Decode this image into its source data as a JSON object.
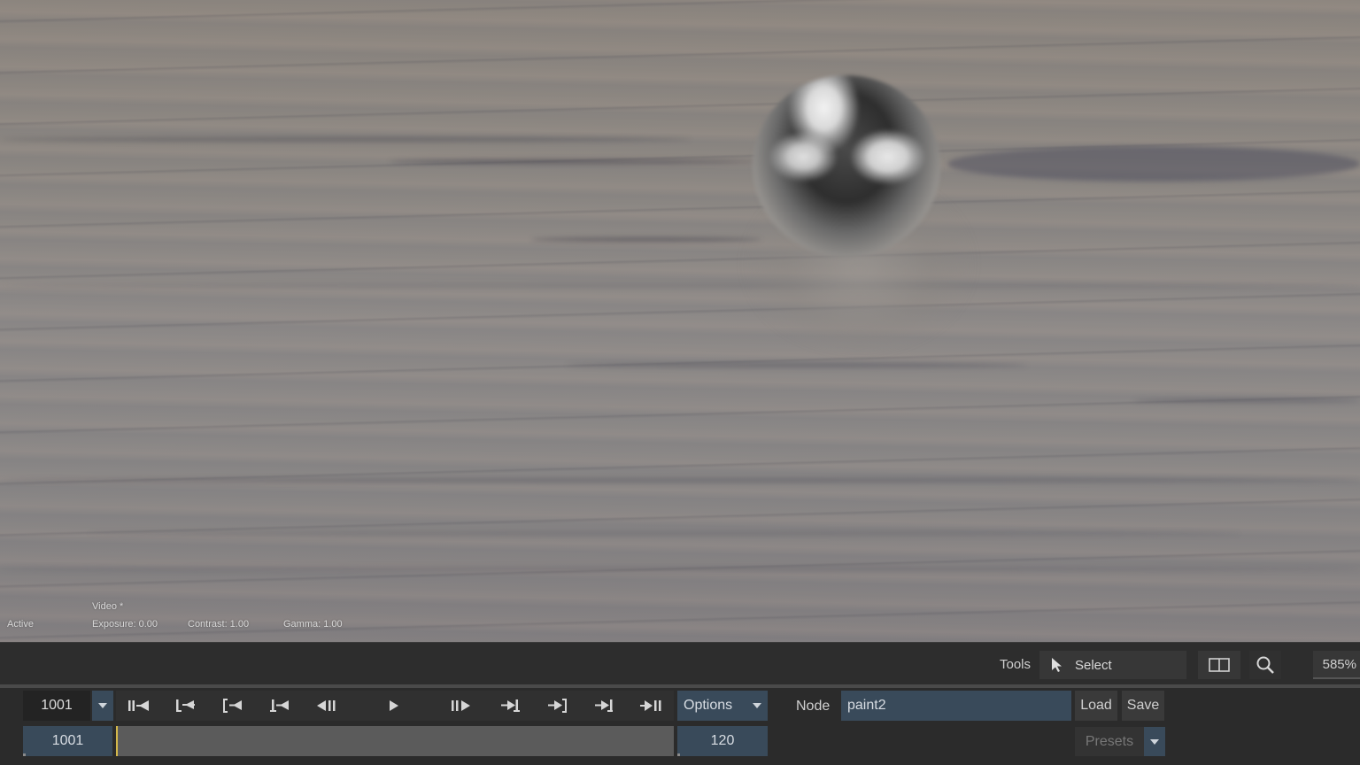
{
  "viewer": {
    "status": "Active",
    "channel": "Video *",
    "exposure": "Exposure: 0.00",
    "contrast": "Contrast: 1.00",
    "gamma": "Gamma: 1.00"
  },
  "toolbar": {
    "tools_label": "Tools",
    "tool_selected": "Select",
    "tool_icon": "arrow-cursor-icon",
    "zoom_level": "585%"
  },
  "transport": {
    "current_frame": "1001",
    "start_frame": "1001",
    "end_frame": "120",
    "playhead_fraction": 0,
    "buttons": [
      "go-to-start",
      "previous-keyframe",
      "previous-mark",
      "step-back-key",
      "step-back",
      "play",
      "step-forward",
      "step-forward-key",
      "next-mark",
      "next-keyframe",
      "go-to-end"
    ],
    "options_label": "Options"
  },
  "node": {
    "label": "Node",
    "value": "paint2",
    "load_label": "Load",
    "save_label": "Save",
    "presets_label": "Presets"
  },
  "colors": {
    "panel_bg": "#2b2b2b",
    "field_blue": "#394a5a",
    "playhead": "#d4b84a",
    "timeline": "#5b5b5b"
  }
}
